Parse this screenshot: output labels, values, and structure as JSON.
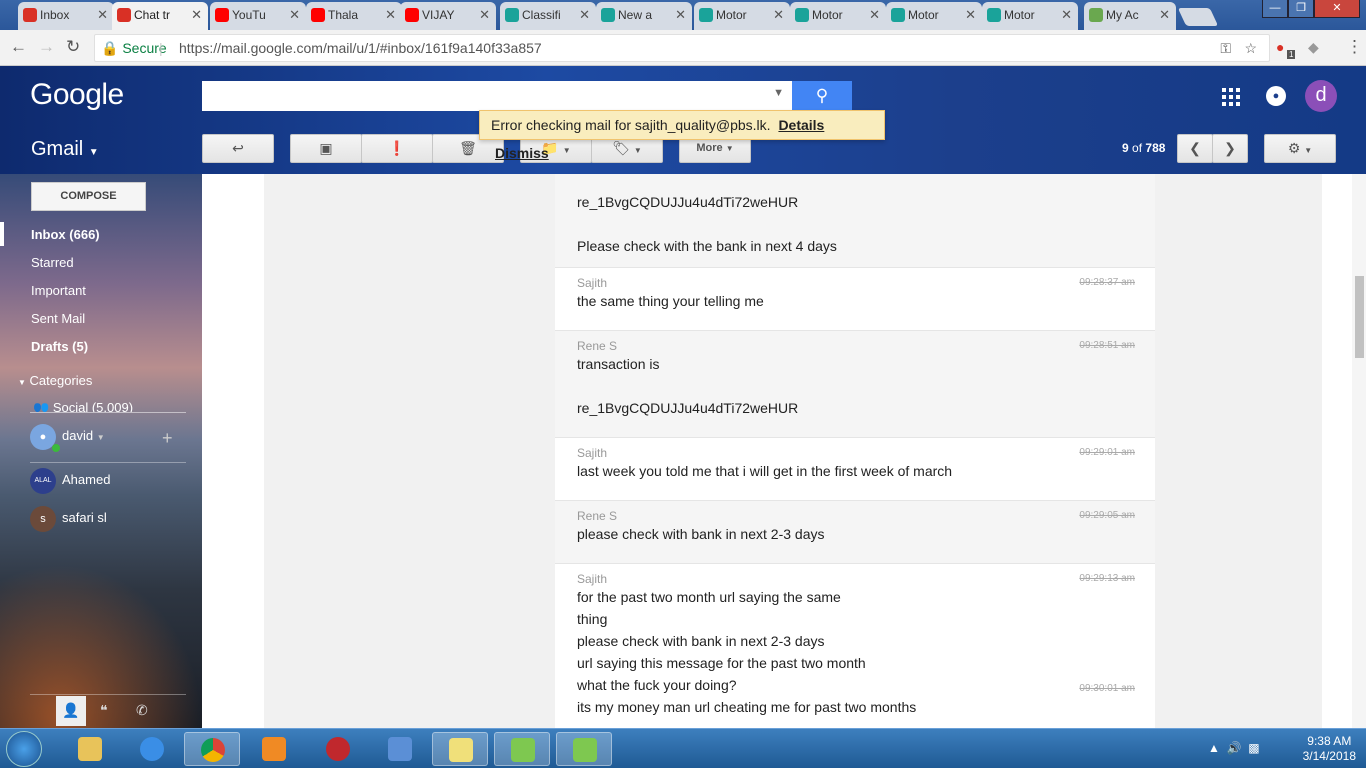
{
  "browser": {
    "tabs": [
      {
        "label": "Inbox",
        "favicon": "gmail-icon",
        "color": "#d93025"
      },
      {
        "label": "Chat tr",
        "favicon": "gmail-icon",
        "color": "#d93025"
      },
      {
        "label": "YouTu",
        "favicon": "youtube-icon",
        "color": "#ff0000"
      },
      {
        "label": "Thala",
        "favicon": "youtube-icon",
        "color": "#ff0000"
      },
      {
        "label": "VIJAY",
        "favicon": "youtube-icon",
        "color": "#ff0000"
      },
      {
        "label": "Classifi",
        "favicon": "green-app-icon",
        "color": "#1aa39a"
      },
      {
        "label": "New a",
        "favicon": "green-app-icon",
        "color": "#1aa39a"
      },
      {
        "label": "Motor",
        "favicon": "green-app-icon",
        "color": "#1aa39a"
      },
      {
        "label": "Motor",
        "favicon": "green-app-icon",
        "color": "#1aa39a"
      },
      {
        "label": "Motor",
        "favicon": "green-app-icon",
        "color": "#1aa39a"
      },
      {
        "label": "Motor",
        "favicon": "green-app-icon",
        "color": "#1aa39a"
      },
      {
        "label": "My Ac",
        "favicon": "leaf-icon",
        "color": "#6aa84f"
      }
    ],
    "security_label": "Secure",
    "url": "https://mail.google.com/mail/u/1/#inbox/161f9a140f33a857",
    "extension_badge": "1"
  },
  "header": {
    "logo": "Google",
    "search_placeholder": "",
    "avatar_letter": "d",
    "app_label": "Gmail",
    "more_label": "More",
    "pager": {
      "current": "9",
      "of_label": "of",
      "total": "788"
    }
  },
  "error_banner": {
    "text": "Error checking mail for sajith_quality@pbs.lk.",
    "details": "Details",
    "dismiss": "Dismiss"
  },
  "sidebar": {
    "compose": "COMPOSE",
    "items": [
      {
        "label": "Inbox (666)",
        "bold": true
      },
      {
        "label": "Starred",
        "bold": false
      },
      {
        "label": "Important",
        "bold": false
      },
      {
        "label": "Sent Mail",
        "bold": false
      },
      {
        "label": "Drafts (5)",
        "bold": true
      },
      {
        "label": "Categories",
        "bold": false
      },
      {
        "label": "Social (5,009)",
        "bold": false
      }
    ],
    "chat": [
      {
        "name": "david",
        "initial": ""
      },
      {
        "name": "Ahamed",
        "initial": "ALAL"
      },
      {
        "name": "safari sl",
        "initial": "s"
      }
    ]
  },
  "conversation": [
    {
      "sender": "",
      "time": "",
      "lines": [
        "re_1BvgCQDUJJu4u4dTi72weHUR",
        "",
        "Please check with the bank in next 4 days"
      ],
      "bg": "grey"
    },
    {
      "sender": "Sajith",
      "time": "09:28:37 am",
      "lines": [
        "the same thing your telling me"
      ],
      "bg": "white"
    },
    {
      "sender": "Rene S",
      "time": "09:28:51 am",
      "lines": [
        "transaction is",
        "",
        "re_1BvgCQDUJJu4u4dTi72weHUR"
      ],
      "bg": "grey"
    },
    {
      "sender": "Sajith",
      "time": "09:29:01 am",
      "lines": [
        "last week you told me that i will get in the first week of march"
      ],
      "bg": "white"
    },
    {
      "sender": "Rene S",
      "time": "09:29:05 am",
      "lines": [
        "please check with bank in next 2-3 days"
      ],
      "bg": "grey"
    },
    {
      "sender": "Sajith",
      "time": "09:29:13 am",
      "time2": "09:30:01 am",
      "lines": [
        "for the past two month url saying the same",
        "thing",
        "please check with bank in next 2-3 days",
        "url saying this message for the past two month",
        "what the fuck your doing?",
        "its my money man url cheating me for past two months"
      ],
      "bg": "white"
    }
  ],
  "taskbar": {
    "time": "9:38 AM",
    "date": "3/14/2018"
  }
}
